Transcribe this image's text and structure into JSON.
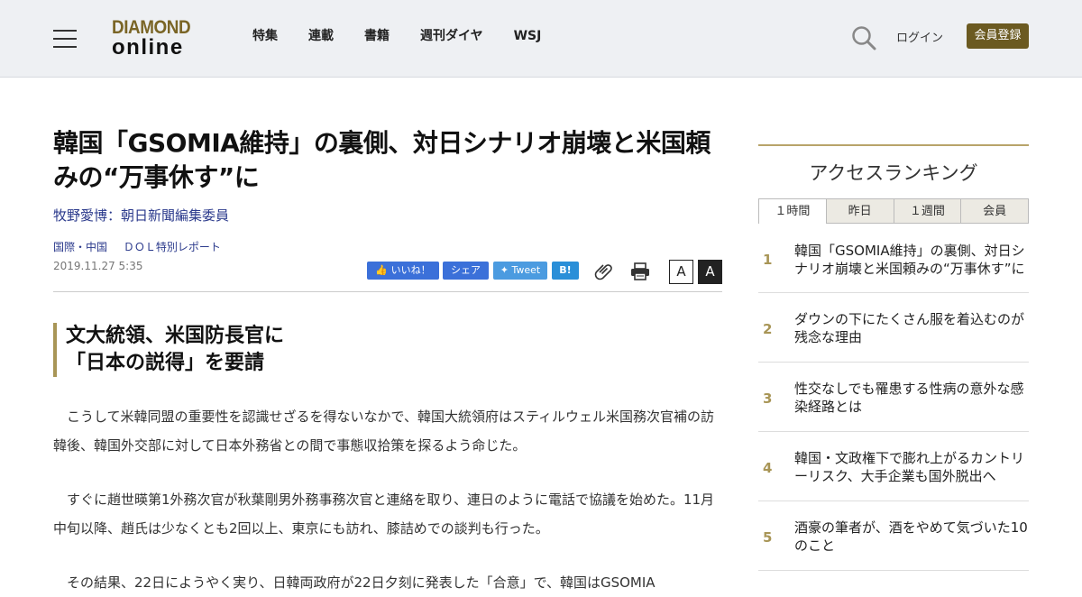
{
  "header": {
    "logo_top": "DIAMOND",
    "logo_bottom": "online",
    "nav": [
      "特集",
      "連載",
      "書籍",
      "週刊ダイヤ",
      "WSJ"
    ],
    "login": "ログイン",
    "register": "会員登録"
  },
  "article": {
    "title": "韓国「GSOMIA維持」の裏側、対日シナリオ崩壊と米国頼みの“万事休す”に",
    "author": "牧野愛博：朝日新聞編集委員",
    "categories": [
      "国際・中国",
      "ＤＯＬ特別レポート"
    ],
    "date": "2019.11.27 5:35",
    "share": {
      "like": "いいね！",
      "share": "シェア",
      "tweet": "Tweet",
      "hatena": "B!"
    },
    "font_small": "A",
    "font_large": "A",
    "subhead_line1": "文大統領、米国防長官に",
    "subhead_line2": "「日本の説得」を要請",
    "paragraphs": [
      "こうして米韓同盟の重要性を認識せざるを得ないなかで、韓国大統領府はスティルウェル米国務次官補の訪韓後、韓国外交部に対して日本外務省との間で事態収拾策を探るよう命じた。",
      "すぐに趙世暎第1外務次官が秋葉剛男外務事務次官と連絡を取り、連日のように電話で協議を始めた。11月中旬以降、趙氏は少なくとも2回以上、東京にも訪れ、膝詰めでの談判も行った。",
      "その結果、22日にようやく実り、日韓両政府が22日夕刻に発表した「合意」で、韓国はGSOMIA"
    ]
  },
  "sidebar": {
    "title": "アクセスランキング",
    "tabs": [
      "１時間",
      "昨日",
      "１週間",
      "会員"
    ],
    "ranking": [
      {
        "num": "1",
        "text": "韓国「GSOMIA維持」の裏側、対日シナリオ崩壊と米国頼みの“万事休す”に"
      },
      {
        "num": "2",
        "text": "ダウンの下にたくさん服を着込むのが残念な理由"
      },
      {
        "num": "3",
        "text": "性交なしでも罹患する性病の意外な感染経路とは"
      },
      {
        "num": "4",
        "text": "韓国・文政権下で膨れ上がるカントリーリスク、大手企業も国外脱出へ"
      },
      {
        "num": "5",
        "text": "酒豪の筆者が、酒をやめて気づいた10のこと"
      }
    ]
  }
}
